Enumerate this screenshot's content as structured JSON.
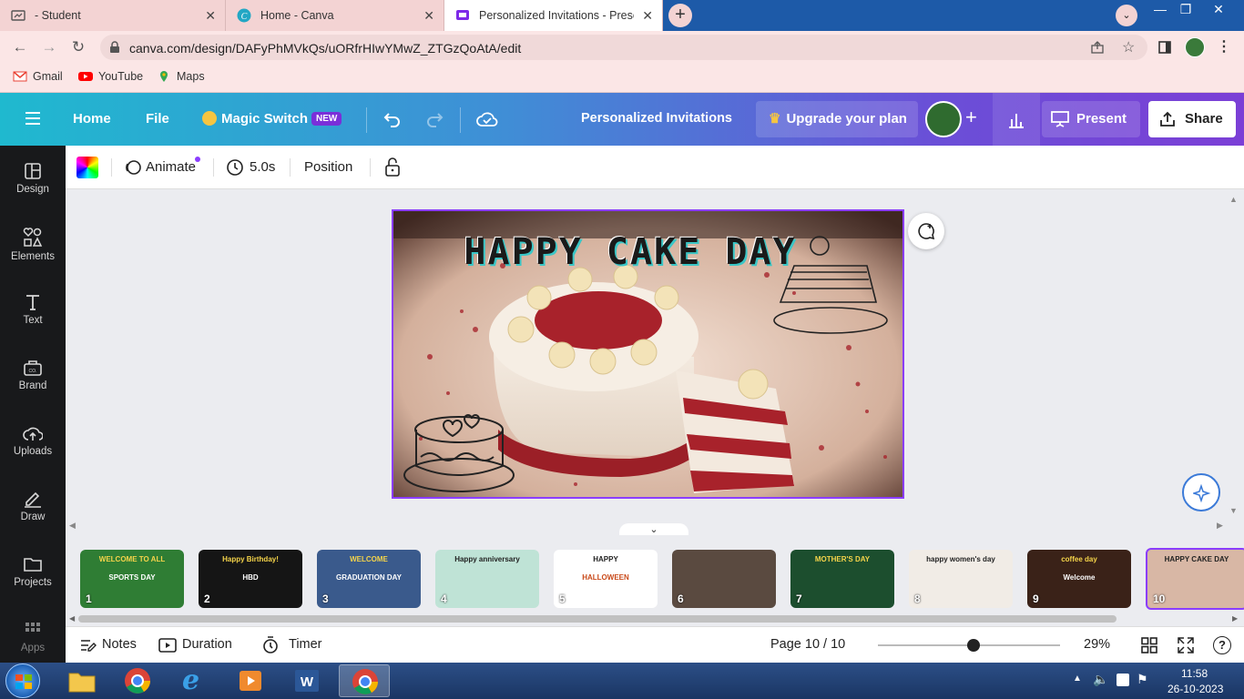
{
  "browser": {
    "tabs": [
      {
        "title": "- Student",
        "active": false
      },
      {
        "title": "Home - Canva",
        "active": false
      },
      {
        "title": "Personalized Invitations - Present",
        "active": true
      }
    ],
    "url": "canva.com/design/DAFyPhMVkQs/uORfrHIwYMwZ_ZTGzQoAtA/edit",
    "bookmarks": [
      "Gmail",
      "YouTube",
      "Maps"
    ]
  },
  "header": {
    "home": "Home",
    "file": "File",
    "magic_switch": "Magic Switch",
    "new_badge": "NEW",
    "title": "Personalized Invitations",
    "upgrade": "Upgrade your plan",
    "present": "Present",
    "share": "Share"
  },
  "sidebar": {
    "items": [
      {
        "label": "Design",
        "icon": "layout-icon"
      },
      {
        "label": "Elements",
        "icon": "shapes-icon"
      },
      {
        "label": "Text",
        "icon": "text-icon"
      },
      {
        "label": "Brand",
        "icon": "brand-icon"
      },
      {
        "label": "Uploads",
        "icon": "upload-cloud-icon"
      },
      {
        "label": "Draw",
        "icon": "pen-icon"
      },
      {
        "label": "Projects",
        "icon": "folder-icon"
      },
      {
        "label": "Apps",
        "icon": "apps-grid-icon"
      }
    ]
  },
  "toolbar": {
    "animate": "Animate",
    "duration": "5.0s",
    "position": "Position"
  },
  "design": {
    "headline": "HAPPY CAKE DAY"
  },
  "filmstrip": {
    "pages": [
      {
        "num": "1",
        "text": "WELCOME TO ALL",
        "sub": "SPORTS DAY",
        "bg": "#2f7d34"
      },
      {
        "num": "2",
        "text": "Happy Birthday!",
        "sub": "HBD",
        "bg": "#151515"
      },
      {
        "num": "3",
        "text": "WELCOME",
        "sub": "GRADUATION DAY",
        "bg": "#3a5a8c"
      },
      {
        "num": "4",
        "text": "Happy anniversary",
        "sub": "",
        "bg": "#bfe3d6"
      },
      {
        "num": "5",
        "text": "HAPPY",
        "sub": "HALLOWEEN",
        "bg": "#ffffff"
      },
      {
        "num": "6",
        "text": "",
        "sub": "",
        "bg": "#5a4a40"
      },
      {
        "num": "7",
        "text": "MOTHER'S DAY",
        "sub": "",
        "bg": "#1c4e2e"
      },
      {
        "num": "8",
        "text": "happy women's day",
        "sub": "",
        "bg": "#f1ece6"
      },
      {
        "num": "9",
        "text": "coffee day",
        "sub": "Welcome",
        "bg": "#3a2218"
      },
      {
        "num": "10",
        "text": "HAPPY CAKE DAY",
        "sub": "",
        "bg": "#d8b7a5"
      }
    ]
  },
  "footer": {
    "notes": "Notes",
    "duration": "Duration",
    "timer": "Timer",
    "page": "Page 10 / 10",
    "zoom": "29%",
    "zoom_value": 0.29
  },
  "taskbar": {
    "time": "11:58",
    "date": "26-10-2023"
  },
  "colors": {
    "accent": "#8b3dff",
    "header_start": "#1fb9cf",
    "header_end": "#7b3fd6"
  }
}
